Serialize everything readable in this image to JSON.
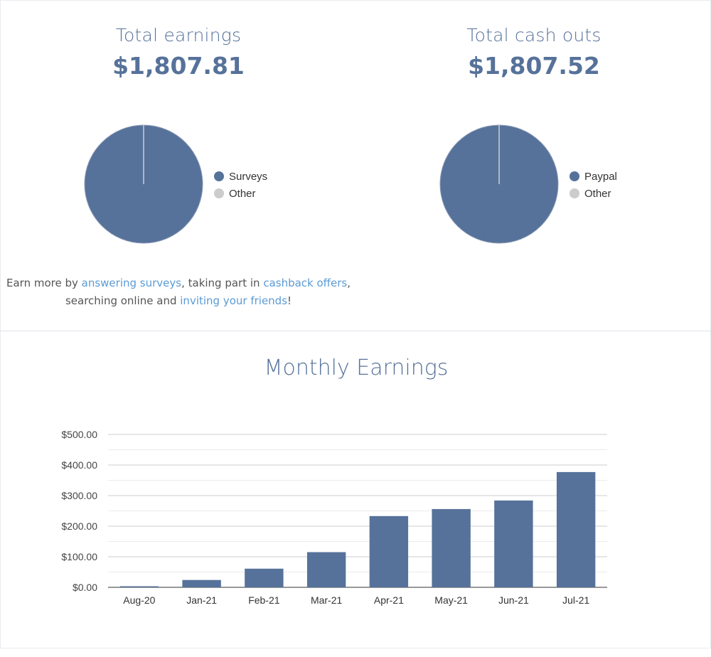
{
  "summary": {
    "earnings": {
      "label": "Total earnings",
      "value": "$1,807.81"
    },
    "cashouts": {
      "label": "Total cash outs",
      "value": "$1,807.52"
    }
  },
  "earnings_pie": {
    "legend": [
      {
        "name": "Surveys",
        "color": "#56729a"
      },
      {
        "name": "Other",
        "color": "#cccccc"
      }
    ]
  },
  "cashouts_pie": {
    "legend": [
      {
        "name": "Paypal",
        "color": "#56729a"
      },
      {
        "name": "Other",
        "color": "#cccccc"
      }
    ]
  },
  "earn_more": {
    "prefix": "Earn more by ",
    "link1": "answering surveys",
    "mid1": ", taking part in ",
    "link2": "cashback offers",
    "mid2": ",",
    "line2_prefix": "searching online and ",
    "link3": "inviting your friends",
    "suffix": "!"
  },
  "monthly": {
    "title": "Monthly Earnings"
  },
  "chart_data": {
    "type": "bar",
    "title": "Monthly Earnings",
    "categories": [
      "Aug-20",
      "Jan-21",
      "Feb-21",
      "Mar-21",
      "Apr-21",
      "May-21",
      "Jun-21",
      "Jul-21"
    ],
    "values": [
      3,
      24,
      61,
      115,
      233,
      256,
      284,
      377
    ],
    "y_ticks": [
      "$0.00",
      "$100.00",
      "$200.00",
      "$300.00",
      "$400.00",
      "$500.00"
    ],
    "ylim": [
      0,
      500
    ],
    "bar_color": "#56729a",
    "grid": true
  }
}
